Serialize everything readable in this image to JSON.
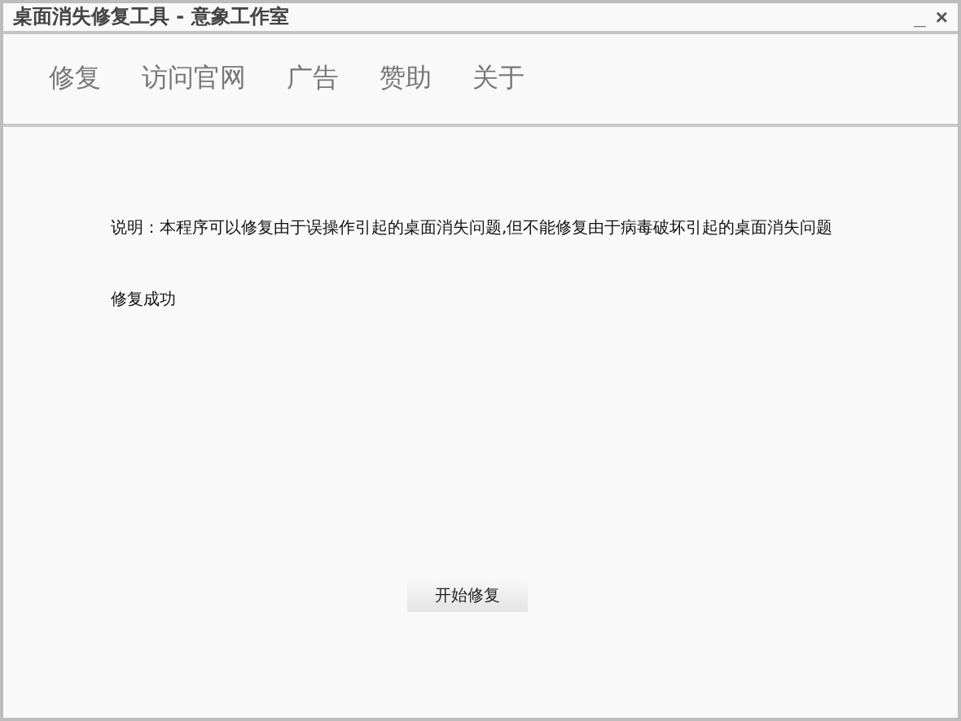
{
  "window": {
    "title": "桌面消失修复工具 - 意象工作室",
    "controls": [
      "_",
      "×"
    ]
  },
  "nav": [
    {
      "label": "修复"
    },
    {
      "label": "访问官网"
    },
    {
      "label": "广告"
    },
    {
      "label": "赞助"
    },
    {
      "label": "关于"
    }
  ],
  "description": "说明：本程序可以修复由于误操作引起的桌面消失问题,但不能修复由于病毒破坏引起的桌面消失问题",
  "status": "修复成功",
  "button": "开始修复"
}
